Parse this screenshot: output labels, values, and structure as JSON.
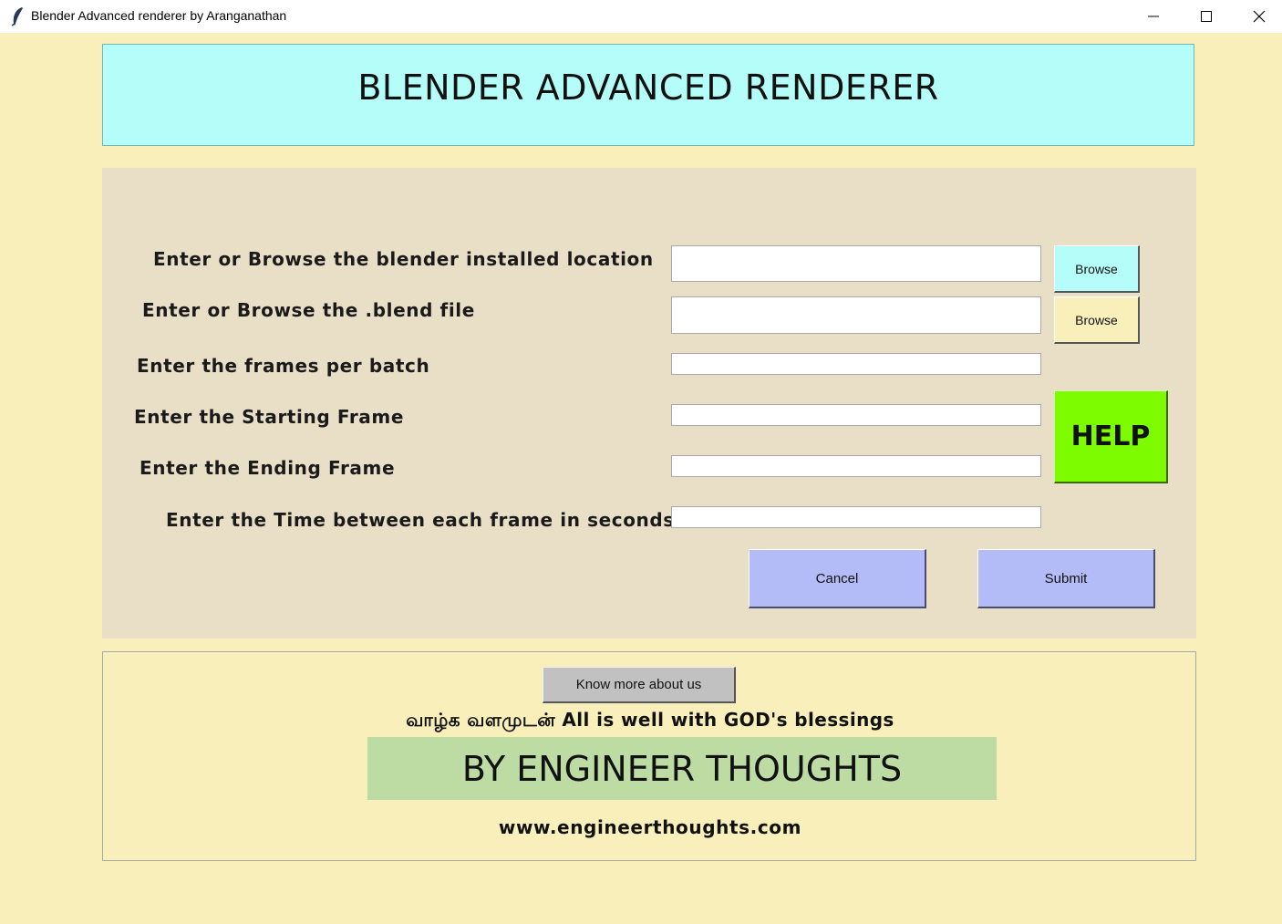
{
  "window": {
    "title": "Blender Advanced renderer by Aranganathan",
    "icon": "feather-icon",
    "controls": [
      "minimize",
      "maximize",
      "close"
    ]
  },
  "header": {
    "title": "BLENDER ADVANCED RENDERER",
    "background": "#b5fdf8"
  },
  "form": {
    "blender_location_label": "Enter or Browse the blender installed location",
    "blend_file_label": "Enter or Browse the .blend file",
    "frames_per_batch_label": "Enter the frames per batch",
    "starting_frame_label": "Enter the Starting Frame",
    "ending_frame_label": "Enter the Ending Frame",
    "time_between_label": "Enter the Time between each frame in seconds",
    "blender_location_value": "",
    "blend_file_value": "",
    "frames_per_batch_value": "",
    "starting_frame_value": "",
    "ending_frame_value": "",
    "time_between_value": "",
    "browse_location_label": "Browse",
    "browse_location_color": "#b5fdf8",
    "browse_blend_label": "Browse",
    "browse_blend_color": "#f9efbb",
    "help_label": "HELP",
    "help_color": "#7dfc00",
    "cancel_label": "Cancel",
    "submit_label": "Submit",
    "action_color": "#b3bcf7",
    "panel_color": "#e9dfc7"
  },
  "footer": {
    "know_more_label": "Know more about us",
    "blessing": "வாழ்க வளமுடன் All is well with GOD's blessings",
    "brand": "BY ENGINEER THOUGHTS",
    "brand_color": "#bcdca4",
    "website": "www.engineerthoughts.com"
  },
  "background_color": "#f9efbb"
}
